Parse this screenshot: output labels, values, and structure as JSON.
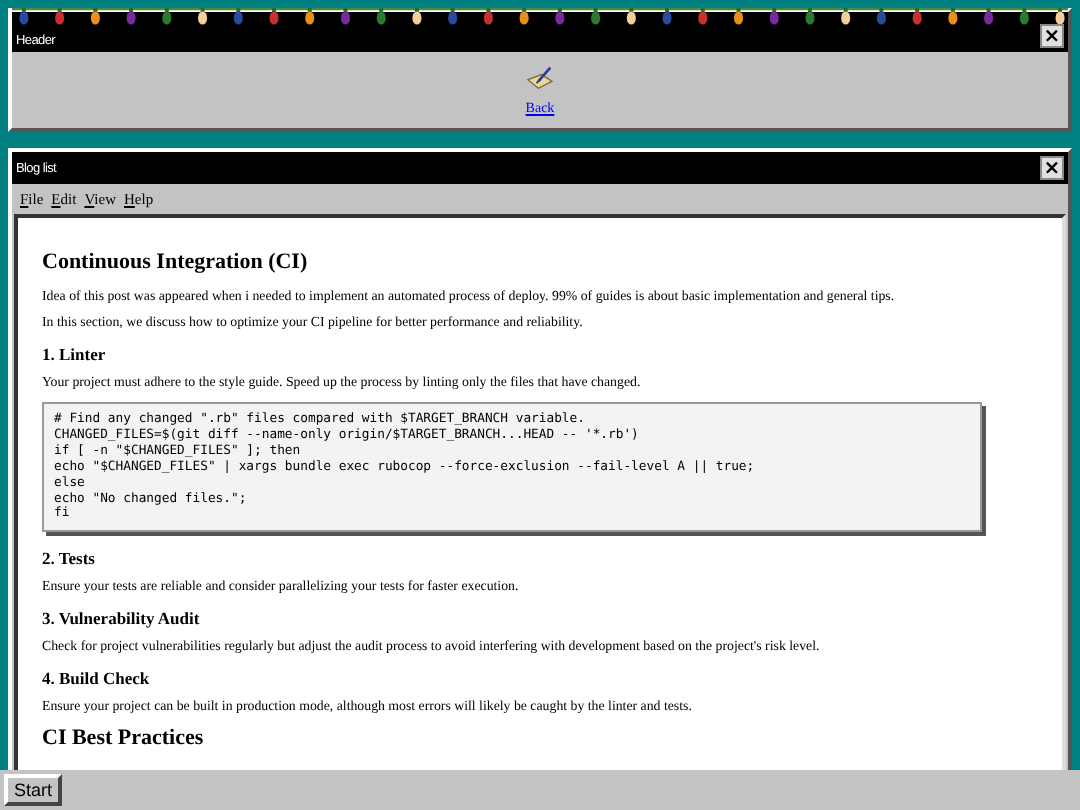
{
  "header_window": {
    "title": "Header",
    "close": "×",
    "link": "Back"
  },
  "blog_window": {
    "title": "Blog list",
    "close": "×",
    "menu": [
      {
        "label": "File"
      },
      {
        "label": "Edit"
      },
      {
        "label": "View"
      },
      {
        "label": "Help"
      }
    ],
    "content": [
      {
        "kind": "h1",
        "text": "Continuous Integration (CI)"
      },
      {
        "kind": "p",
        "text": "Idea of this post was appeared when i needed to implement an automated process of deploy. 99% of guides is about basic implementation and general tips."
      },
      {
        "kind": "p",
        "text": "In this section, we discuss how to optimize your CI pipeline for better performance and reliability."
      },
      {
        "kind": "h2",
        "text": "1. Linter"
      },
      {
        "kind": "p",
        "text": "Your project must adhere to the style guide. Speed up the process by linting only the files that have changed."
      },
      {
        "kind": "code",
        "lines": [
          "# Find any changed \".rb\" files compared with $TARGET_BRANCH variable.",
          "CHANGED_FILES=$(git diff --name-only origin/$TARGET_BRANCH...HEAD -- '*.rb')",
          "if [ -n \"$CHANGED_FILES\" ]; then",
          "echo \"$CHANGED_FILES\" | xargs bundle exec rubocop --force-exclusion --fail-level A || true;",
          "else",
          "echo \"No changed files.\";",
          "fi"
        ]
      },
      {
        "kind": "h2",
        "text": "2. Tests"
      },
      {
        "kind": "p",
        "text": "Ensure your tests are reliable and consider parallelizing your tests for faster execution."
      },
      {
        "kind": "h2",
        "text": "3. Vulnerability Audit"
      },
      {
        "kind": "p",
        "text": "Check for project vulnerabilities regularly but adjust the audit process to avoid interfering with development based on the project's risk level."
      },
      {
        "kind": "h2",
        "text": "4. Build Check"
      },
      {
        "kind": "p",
        "text": "Ensure your project can be built in production mode, although most errors will likely be caught by the linter and tests."
      },
      {
        "kind": "h1",
        "text": "CI Best Practices"
      }
    ]
  },
  "taskbar": {
    "start": "Start"
  }
}
